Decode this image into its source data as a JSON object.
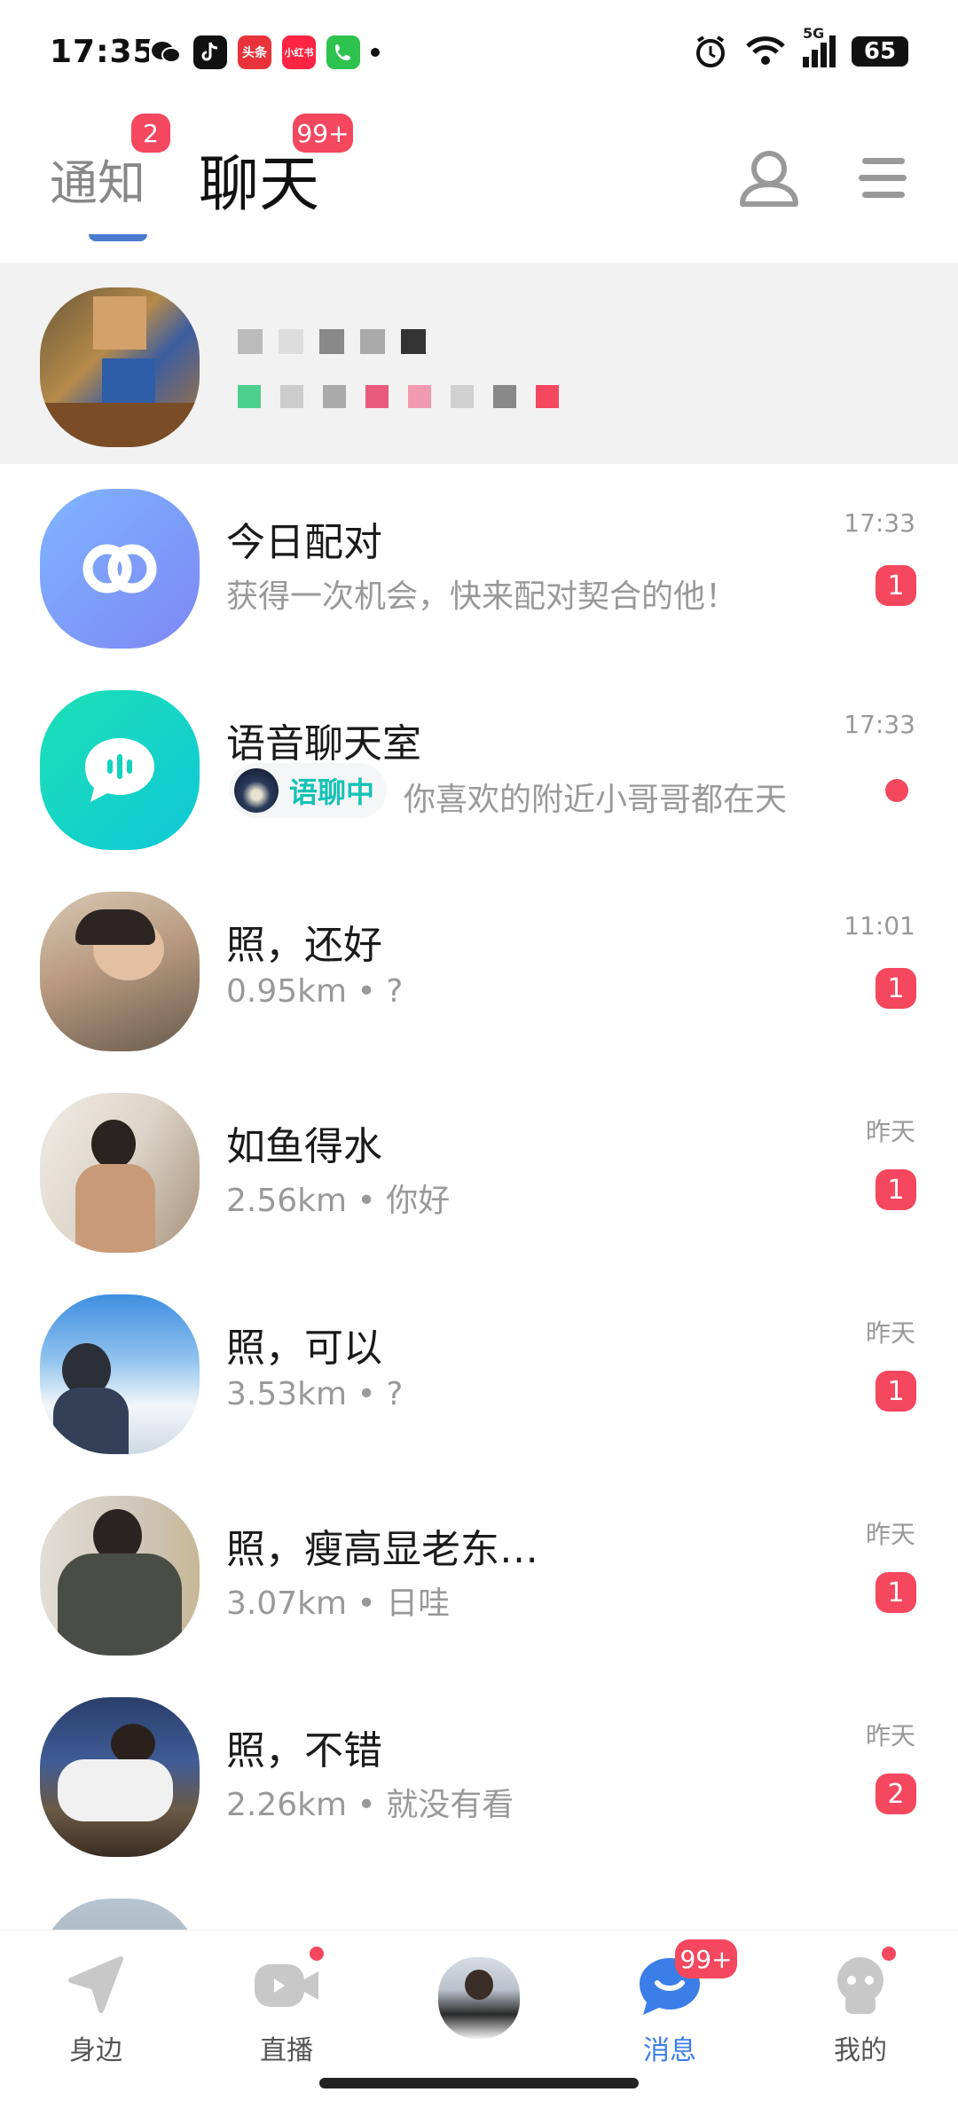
{
  "status": {
    "time": "17:35",
    "battery": "65",
    "network": "5G",
    "apps": [
      "头条",
      "小红书"
    ]
  },
  "header": {
    "tab_notice": "通知",
    "tab_notice_badge": "2",
    "tab_chat": "聊天",
    "tab_chat_badge": "99+"
  },
  "chats": [
    {
      "name": "今日配对",
      "subtitle": "获得一次机会，快来配对契合的他！",
      "time": "17:33",
      "count": "1"
    },
    {
      "name": "语音聊天室",
      "tag": "语聊中",
      "subtitle": "你喜欢的附近小哥哥都在天",
      "time": "17:33"
    },
    {
      "name": "照，还好",
      "subtitle": "0.95km • ?",
      "time": "11:01",
      "count": "1"
    },
    {
      "name": "如鱼得水",
      "subtitle": "2.56km • 你好",
      "time": "昨天",
      "count": "1"
    },
    {
      "name": "照，可以",
      "subtitle": "3.53km • ?",
      "time": "昨天",
      "count": "1"
    },
    {
      "name": "照，瘦高显老东…",
      "subtitle": "3.07km • 日哇",
      "time": "昨天",
      "count": "1"
    },
    {
      "name": "照，不错",
      "subtitle": "2.26km • 就没有看",
      "time": "昨天",
      "count": "2"
    }
  ],
  "nav": [
    {
      "label": "身边"
    },
    {
      "label": "直播"
    },
    {
      "label": ""
    },
    {
      "label": "消息",
      "badge": "99+"
    },
    {
      "label": "我的"
    }
  ],
  "colors": {
    "accent": "#3b7ee8",
    "badge": "#f5475e",
    "highlight_row": "#f2f2f2"
  }
}
